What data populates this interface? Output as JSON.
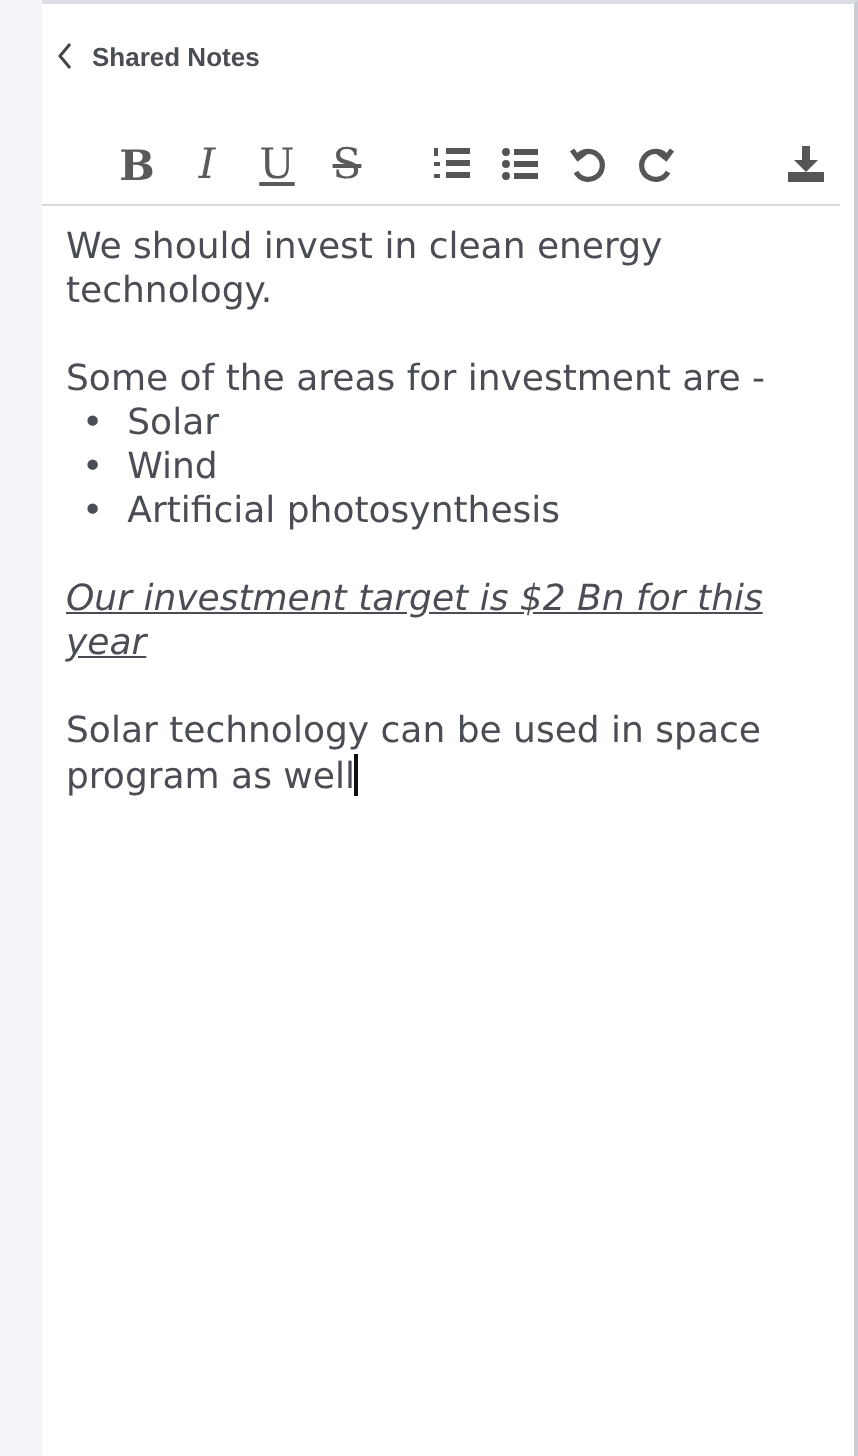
{
  "header": {
    "title": "Shared Notes"
  },
  "toolbar": {
    "format_buttons": [
      {
        "kind": "bold",
        "label": "B"
      },
      {
        "kind": "italic",
        "label": "I"
      },
      {
        "kind": "underline",
        "label": "U"
      },
      {
        "kind": "strike",
        "label": "S"
      }
    ],
    "action_buttons": [
      {
        "kind": "numbered-list"
      },
      {
        "kind": "bullet-list"
      },
      {
        "kind": "undo"
      },
      {
        "kind": "redo"
      }
    ],
    "end_buttons": [
      {
        "kind": "download"
      }
    ]
  },
  "blocks": [
    {
      "kind": "text",
      "text": "We should invest in clean energy technology.",
      "caret": false
    },
    {
      "kind": "text",
      "text": "Some of the areas for investment are -",
      "caret": false
    },
    {
      "kind": "bullets",
      "marker": "•",
      "items": [
        "Solar",
        "Wind",
        "Artificial photosynthesis"
      ]
    },
    {
      "kind": "emphasis",
      "text": "Our investment target is $2 Bn for this year",
      "caret": false
    },
    {
      "kind": "text",
      "text": "Solar technology can be used in space program as well",
      "caret": true
    }
  ]
}
